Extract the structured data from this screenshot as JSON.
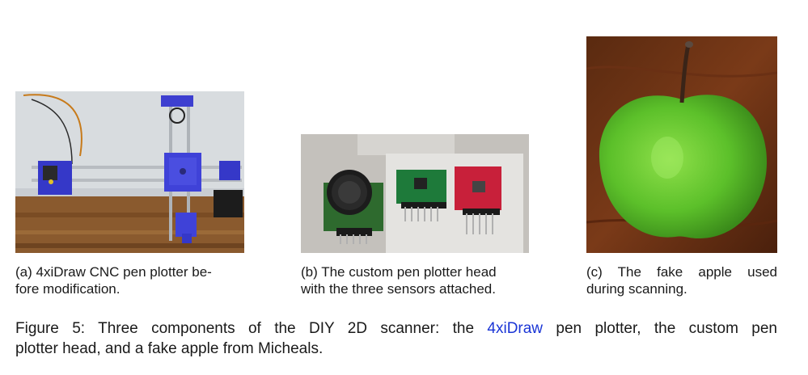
{
  "figure": {
    "subfigures": [
      {
        "caption_line1": "(a) 4xiDraw CNC pen plotter be-",
        "caption_line2": "fore modification."
      },
      {
        "caption_line1": "(b) The custom pen plotter head",
        "caption_line2": "with the three sensors attached."
      },
      {
        "caption_line1": "(c) The fake apple used",
        "caption_line2": "during scanning."
      }
    ],
    "caption": {
      "prefix": "Figure 5:  Three components of the DIY 2D scanner:  the ",
      "link_text": "4xiDraw",
      "line1_suffix": " pen plotter, the custom pen",
      "line2": "plotter head, and a fake apple from Micheals."
    }
  },
  "colors": {
    "link": "#1a35d6",
    "text": "#1a1a1a"
  }
}
